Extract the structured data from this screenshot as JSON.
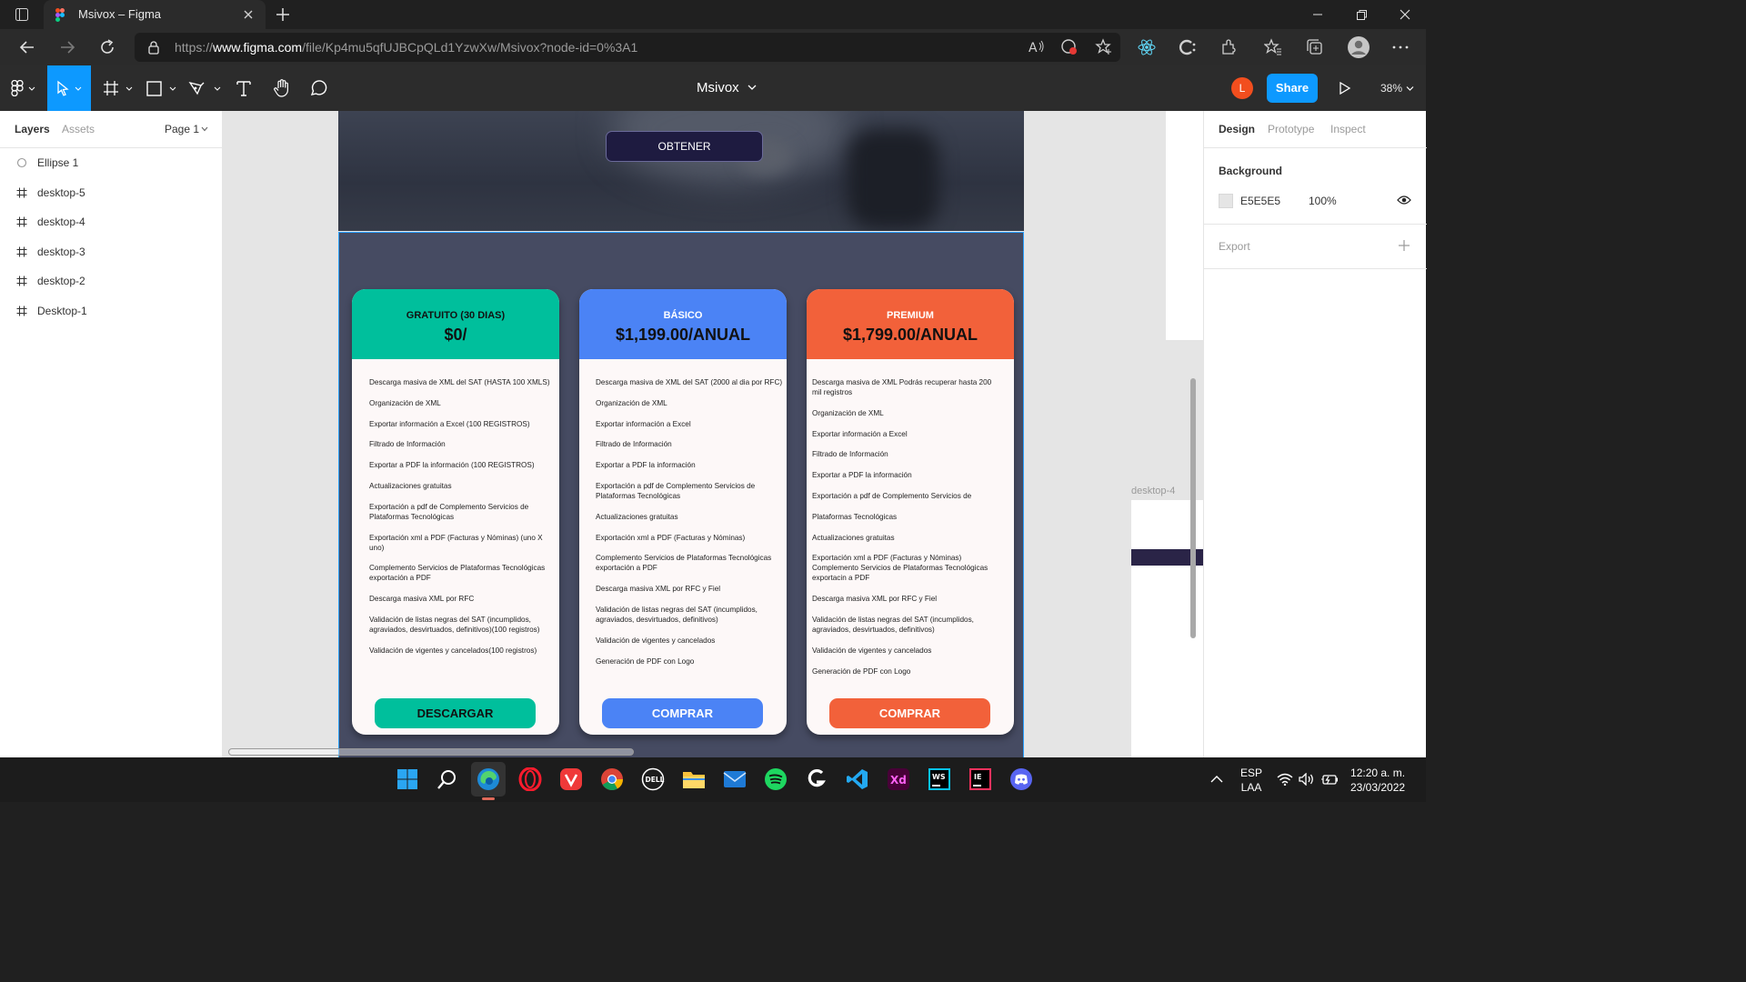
{
  "browser": {
    "tab_title": "Msivox – Figma",
    "url_prefix": "https://",
    "url_host": "www.figma.com",
    "url_path": "/file/Kp4mu5qfUJBCpQLd1YzwXw/Msivox?node-id=0%3A1"
  },
  "toolbar": {
    "file_name": "Msivox",
    "avatar_initial": "L",
    "share_label": "Share",
    "zoom": "38%"
  },
  "left_panel": {
    "tabs": [
      "Layers",
      "Assets"
    ],
    "page": "Page 1",
    "layers": [
      {
        "name": "Ellipse 1",
        "icon": "ellipse-icon"
      },
      {
        "name": "desktop-5",
        "icon": "frame-icon"
      },
      {
        "name": "desktop-4",
        "icon": "frame-icon"
      },
      {
        "name": "desktop-3",
        "icon": "frame-icon"
      },
      {
        "name": "desktop-2",
        "icon": "frame-icon"
      },
      {
        "name": "Desktop-1",
        "icon": "frame-icon"
      }
    ]
  },
  "canvas": {
    "hero_button": "OBTENER",
    "side_frame_label": "desktop-4",
    "help": "?",
    "cards": [
      {
        "plan": "GRATUITO (30 DIAS)",
        "price": "$0/",
        "color": "#00bf9c",
        "features": [
          "Descarga masiva de XML del SAT (HASTA 100 XMLS)",
          "Organización de XML",
          "Exportar información a Excel (100 REGISTROS)",
          "Filtrado de Información",
          "Exportar a PDF la información (100 REGISTROS)",
          "Actualizaciones gratuitas",
          "Exportación a pdf de Complemento Servicios de Plataformas Tecnológicas",
          "Exportación xml a PDF (Facturas y Nóminas) (uno X uno)",
          "Complemento Servicios de Plataformas Tecnológicas exportación a PDF",
          "Descarga masiva XML por RFC",
          "Validación de listas negras del SAT (incumplidos, agraviados, desvirtuados, definitivos)(100 registros)",
          "Validación de vigentes y cancelados(100 registros)"
        ],
        "cta": "DESCARGAR"
      },
      {
        "plan": "BÁSICO",
        "price": "$1,199.00/ANUAL",
        "color": "#4b83f5",
        "features": [
          "Descarga masiva de XML del SAT (2000 al dia por RFC)",
          "Organización de XML",
          "Exportar información a Excel",
          "Filtrado de Información",
          "Exportar a PDF la información",
          "Exportación a pdf de Complemento Servicios de Plataformas Tecnológicas",
          "Actualizaciones gratuitas",
          "Exportación xml a PDF (Facturas y Nóminas)",
          "Complemento Servicios de Plataformas Tecnológicas exportación a PDF",
          "Descarga masiva XML por RFC y Fiel",
          "Validación de listas negras del SAT (incumplidos, agraviados, desvirtuados, definitivos)",
          "Validación de vigentes y cancelados",
          "Generación de PDF con Logo"
        ],
        "cta": "COMPRAR"
      },
      {
        "plan": "PREMIUM",
        "price": "$1,799.00/ANUAL",
        "color": "#f2613a",
        "features": [
          "Descarga masiva de XML Podrás recuperar hasta 200 mil registros",
          "Organización de XML",
          "Exportar información a Excel",
          "Filtrado de Información",
          "Exportar a PDF la información",
          "Exportación a pdf de Complemento Servicios de",
          "Plataformas Tecnológicas",
          "Actualizaciones gratuitas",
          "Exportación xml a PDF (Facturas y Nóminas) Complemento Servicios de Plataformas Tecnológicas exportacin a PDF",
          "Descarga masiva XML por RFC y Fiel",
          "Validación de listas negras del SAT (incumplidos, agraviados, desvirtuados, definitivos)",
          "Validación de vigentes y cancelados",
          "Generación de PDF con Logo"
        ],
        "cta": "COMPRAR"
      }
    ]
  },
  "right_panel": {
    "tabs": [
      "Design",
      "Prototype",
      "Inspect"
    ],
    "background_title": "Background",
    "background_hex": "E5E5E5",
    "background_opacity": "100%",
    "export_title": "Export"
  },
  "taskbar": {
    "lang_1": "ESP",
    "lang_2": "LAA",
    "time": "12:20 a. m.",
    "date": "23/03/2022"
  }
}
